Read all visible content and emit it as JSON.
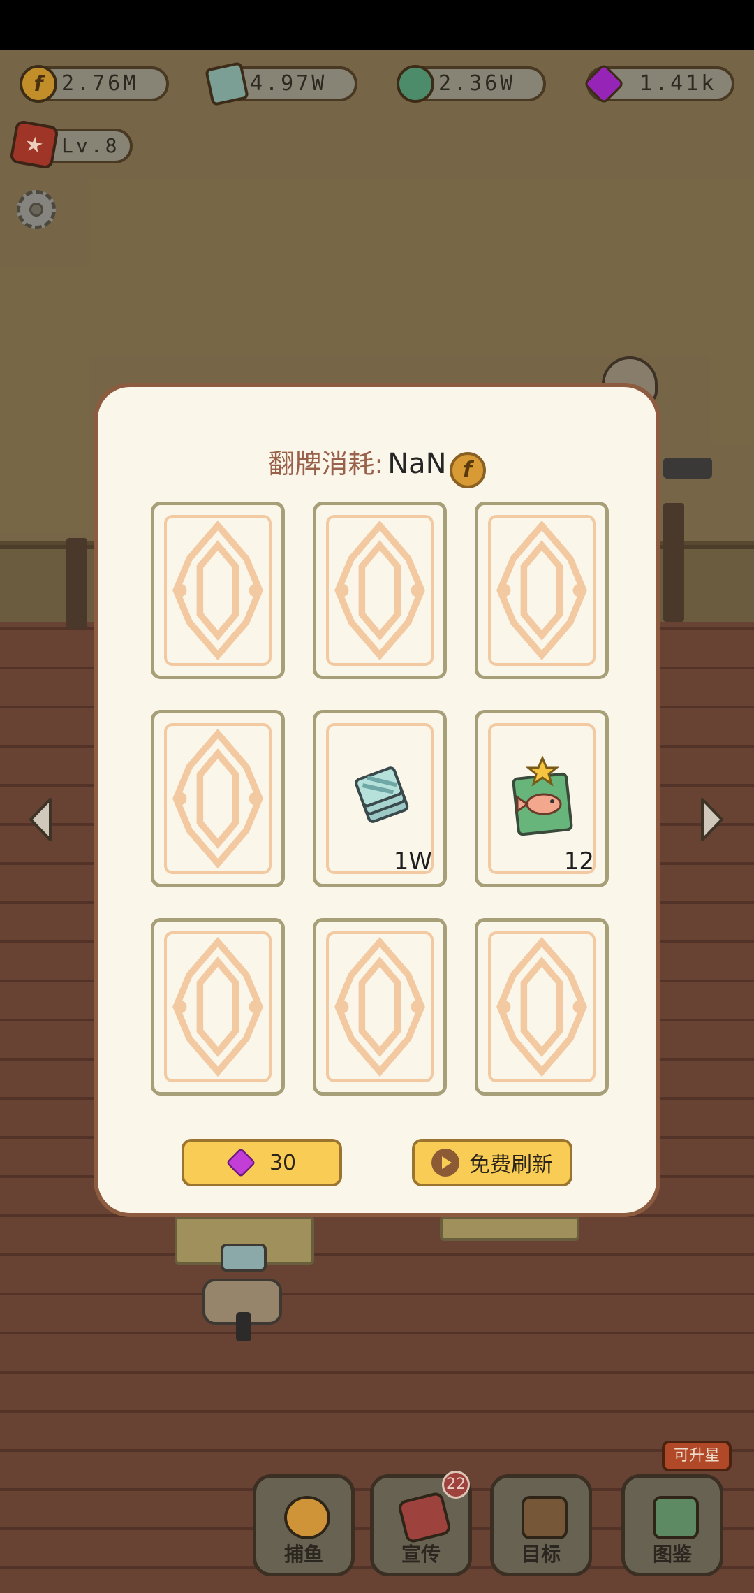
{
  "hud": {
    "currencies": [
      {
        "icon": "coin-icon",
        "value": "2.76M"
      },
      {
        "icon": "ticket-icon",
        "value": "4.97W"
      },
      {
        "icon": "cash-icon",
        "value": "2.36W"
      },
      {
        "icon": "gem-icon",
        "value": "1.41k"
      }
    ],
    "level": "Lv.8"
  },
  "dialog": {
    "title": "翻牌消耗:",
    "cost_value": "NaN",
    "cost_icon": "coin-icon",
    "cards": [
      {
        "state": "face-down"
      },
      {
        "state": "face-down"
      },
      {
        "state": "face-down"
      },
      {
        "state": "face-down"
      },
      {
        "state": "revealed",
        "reward_icon": "ticket-icon",
        "amount": "1W"
      },
      {
        "state": "revealed",
        "reward_icon": "fish-book-icon",
        "amount": "12"
      },
      {
        "state": "face-down"
      },
      {
        "state": "face-down"
      },
      {
        "state": "face-down"
      }
    ],
    "gem_button": {
      "icon": "gem-icon",
      "label": "30"
    },
    "refresh_button": {
      "icon": "play-icon",
      "label": "免费刷新"
    }
  },
  "bottom_nav": [
    {
      "label": "捕鱼",
      "icon": "submarine-icon"
    },
    {
      "label": "宣传",
      "icon": "flyer-icon",
      "badge": "22"
    },
    {
      "label": "目标",
      "icon": "clipboard-icon"
    },
    {
      "label": "图鉴",
      "icon": "fish-book-icon",
      "tooltip": "可升星"
    }
  ],
  "colors": {
    "dialog_bg": "#fbf6ea",
    "dialog_border": "#8d5b3f",
    "button_yellow": "#f9cd55",
    "card_border": "#a79f78",
    "card_pattern": "#f2c9a1"
  }
}
